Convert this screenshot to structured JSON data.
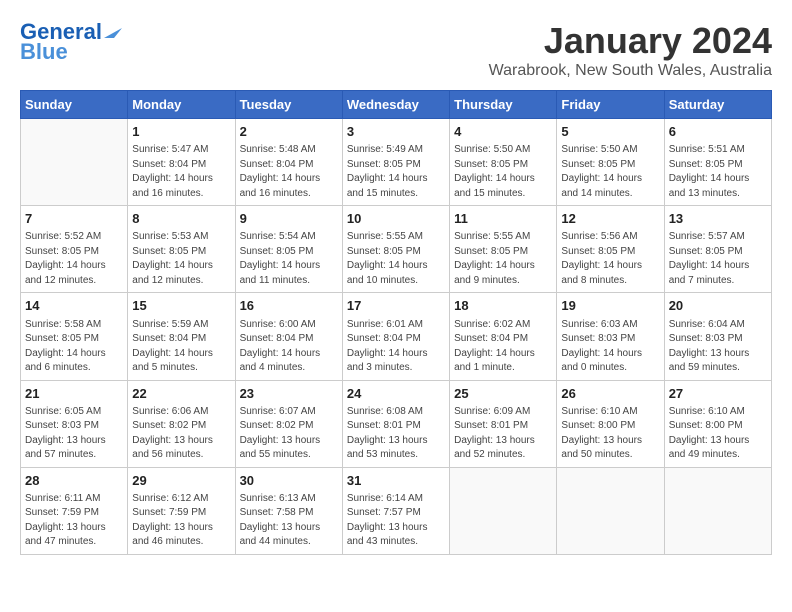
{
  "header": {
    "logo_line1": "General",
    "logo_line2": "Blue",
    "title": "January 2024",
    "subtitle": "Warabrook, New South Wales, Australia"
  },
  "weekdays": [
    "Sunday",
    "Monday",
    "Tuesday",
    "Wednesday",
    "Thursday",
    "Friday",
    "Saturday"
  ],
  "weeks": [
    [
      {
        "day": "",
        "info": ""
      },
      {
        "day": "1",
        "info": "Sunrise: 5:47 AM\nSunset: 8:04 PM\nDaylight: 14 hours\nand 16 minutes."
      },
      {
        "day": "2",
        "info": "Sunrise: 5:48 AM\nSunset: 8:04 PM\nDaylight: 14 hours\nand 16 minutes."
      },
      {
        "day": "3",
        "info": "Sunrise: 5:49 AM\nSunset: 8:05 PM\nDaylight: 14 hours\nand 15 minutes."
      },
      {
        "day": "4",
        "info": "Sunrise: 5:50 AM\nSunset: 8:05 PM\nDaylight: 14 hours\nand 15 minutes."
      },
      {
        "day": "5",
        "info": "Sunrise: 5:50 AM\nSunset: 8:05 PM\nDaylight: 14 hours\nand 14 minutes."
      },
      {
        "day": "6",
        "info": "Sunrise: 5:51 AM\nSunset: 8:05 PM\nDaylight: 14 hours\nand 13 minutes."
      }
    ],
    [
      {
        "day": "7",
        "info": "Sunrise: 5:52 AM\nSunset: 8:05 PM\nDaylight: 14 hours\nand 12 minutes."
      },
      {
        "day": "8",
        "info": "Sunrise: 5:53 AM\nSunset: 8:05 PM\nDaylight: 14 hours\nand 12 minutes."
      },
      {
        "day": "9",
        "info": "Sunrise: 5:54 AM\nSunset: 8:05 PM\nDaylight: 14 hours\nand 11 minutes."
      },
      {
        "day": "10",
        "info": "Sunrise: 5:55 AM\nSunset: 8:05 PM\nDaylight: 14 hours\nand 10 minutes."
      },
      {
        "day": "11",
        "info": "Sunrise: 5:55 AM\nSunset: 8:05 PM\nDaylight: 14 hours\nand 9 minutes."
      },
      {
        "day": "12",
        "info": "Sunrise: 5:56 AM\nSunset: 8:05 PM\nDaylight: 14 hours\nand 8 minutes."
      },
      {
        "day": "13",
        "info": "Sunrise: 5:57 AM\nSunset: 8:05 PM\nDaylight: 14 hours\nand 7 minutes."
      }
    ],
    [
      {
        "day": "14",
        "info": "Sunrise: 5:58 AM\nSunset: 8:05 PM\nDaylight: 14 hours\nand 6 minutes."
      },
      {
        "day": "15",
        "info": "Sunrise: 5:59 AM\nSunset: 8:04 PM\nDaylight: 14 hours\nand 5 minutes."
      },
      {
        "day": "16",
        "info": "Sunrise: 6:00 AM\nSunset: 8:04 PM\nDaylight: 14 hours\nand 4 minutes."
      },
      {
        "day": "17",
        "info": "Sunrise: 6:01 AM\nSunset: 8:04 PM\nDaylight: 14 hours\nand 3 minutes."
      },
      {
        "day": "18",
        "info": "Sunrise: 6:02 AM\nSunset: 8:04 PM\nDaylight: 14 hours\nand 1 minute."
      },
      {
        "day": "19",
        "info": "Sunrise: 6:03 AM\nSunset: 8:03 PM\nDaylight: 14 hours\nand 0 minutes."
      },
      {
        "day": "20",
        "info": "Sunrise: 6:04 AM\nSunset: 8:03 PM\nDaylight: 13 hours\nand 59 minutes."
      }
    ],
    [
      {
        "day": "21",
        "info": "Sunrise: 6:05 AM\nSunset: 8:03 PM\nDaylight: 13 hours\nand 57 minutes."
      },
      {
        "day": "22",
        "info": "Sunrise: 6:06 AM\nSunset: 8:02 PM\nDaylight: 13 hours\nand 56 minutes."
      },
      {
        "day": "23",
        "info": "Sunrise: 6:07 AM\nSunset: 8:02 PM\nDaylight: 13 hours\nand 55 minutes."
      },
      {
        "day": "24",
        "info": "Sunrise: 6:08 AM\nSunset: 8:01 PM\nDaylight: 13 hours\nand 53 minutes."
      },
      {
        "day": "25",
        "info": "Sunrise: 6:09 AM\nSunset: 8:01 PM\nDaylight: 13 hours\nand 52 minutes."
      },
      {
        "day": "26",
        "info": "Sunrise: 6:10 AM\nSunset: 8:00 PM\nDaylight: 13 hours\nand 50 minutes."
      },
      {
        "day": "27",
        "info": "Sunrise: 6:10 AM\nSunset: 8:00 PM\nDaylight: 13 hours\nand 49 minutes."
      }
    ],
    [
      {
        "day": "28",
        "info": "Sunrise: 6:11 AM\nSunset: 7:59 PM\nDaylight: 13 hours\nand 47 minutes."
      },
      {
        "day": "29",
        "info": "Sunrise: 6:12 AM\nSunset: 7:59 PM\nDaylight: 13 hours\nand 46 minutes."
      },
      {
        "day": "30",
        "info": "Sunrise: 6:13 AM\nSunset: 7:58 PM\nDaylight: 13 hours\nand 44 minutes."
      },
      {
        "day": "31",
        "info": "Sunrise: 6:14 AM\nSunset: 7:57 PM\nDaylight: 13 hours\nand 43 minutes."
      },
      {
        "day": "",
        "info": ""
      },
      {
        "day": "",
        "info": ""
      },
      {
        "day": "",
        "info": ""
      }
    ]
  ]
}
